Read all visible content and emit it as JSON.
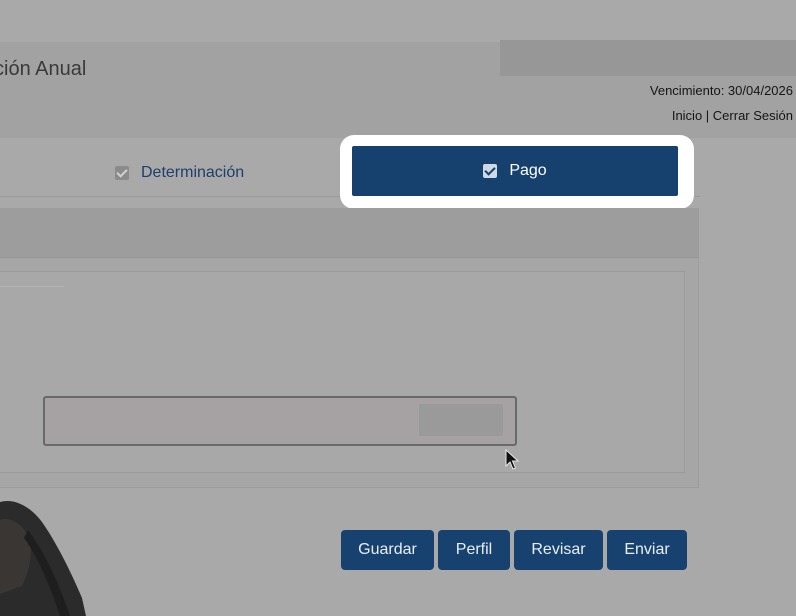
{
  "header": {
    "title": "ción Anual",
    "due_date": "Vencimiento: 30/04/2026",
    "links": {
      "home": "Inicio",
      "separator": " | ",
      "logout": "Cerrar Sesión"
    }
  },
  "tabs": [
    {
      "label": "Determinación",
      "checked": true,
      "active": false
    },
    {
      "label": "Pago",
      "checked": true,
      "active": true
    }
  ],
  "buttons": {
    "save": "Guardar",
    "profile": "Perfil",
    "review": "Revisar",
    "send": "Enviar"
  },
  "icons": {
    "tab_check": "checkbox-checked-icon",
    "pointer": "mouse-pointer-icon"
  },
  "colors": {
    "accent": "#16406e",
    "highlight": "#ffffff",
    "overlay_gray": "#a9a9a9"
  }
}
